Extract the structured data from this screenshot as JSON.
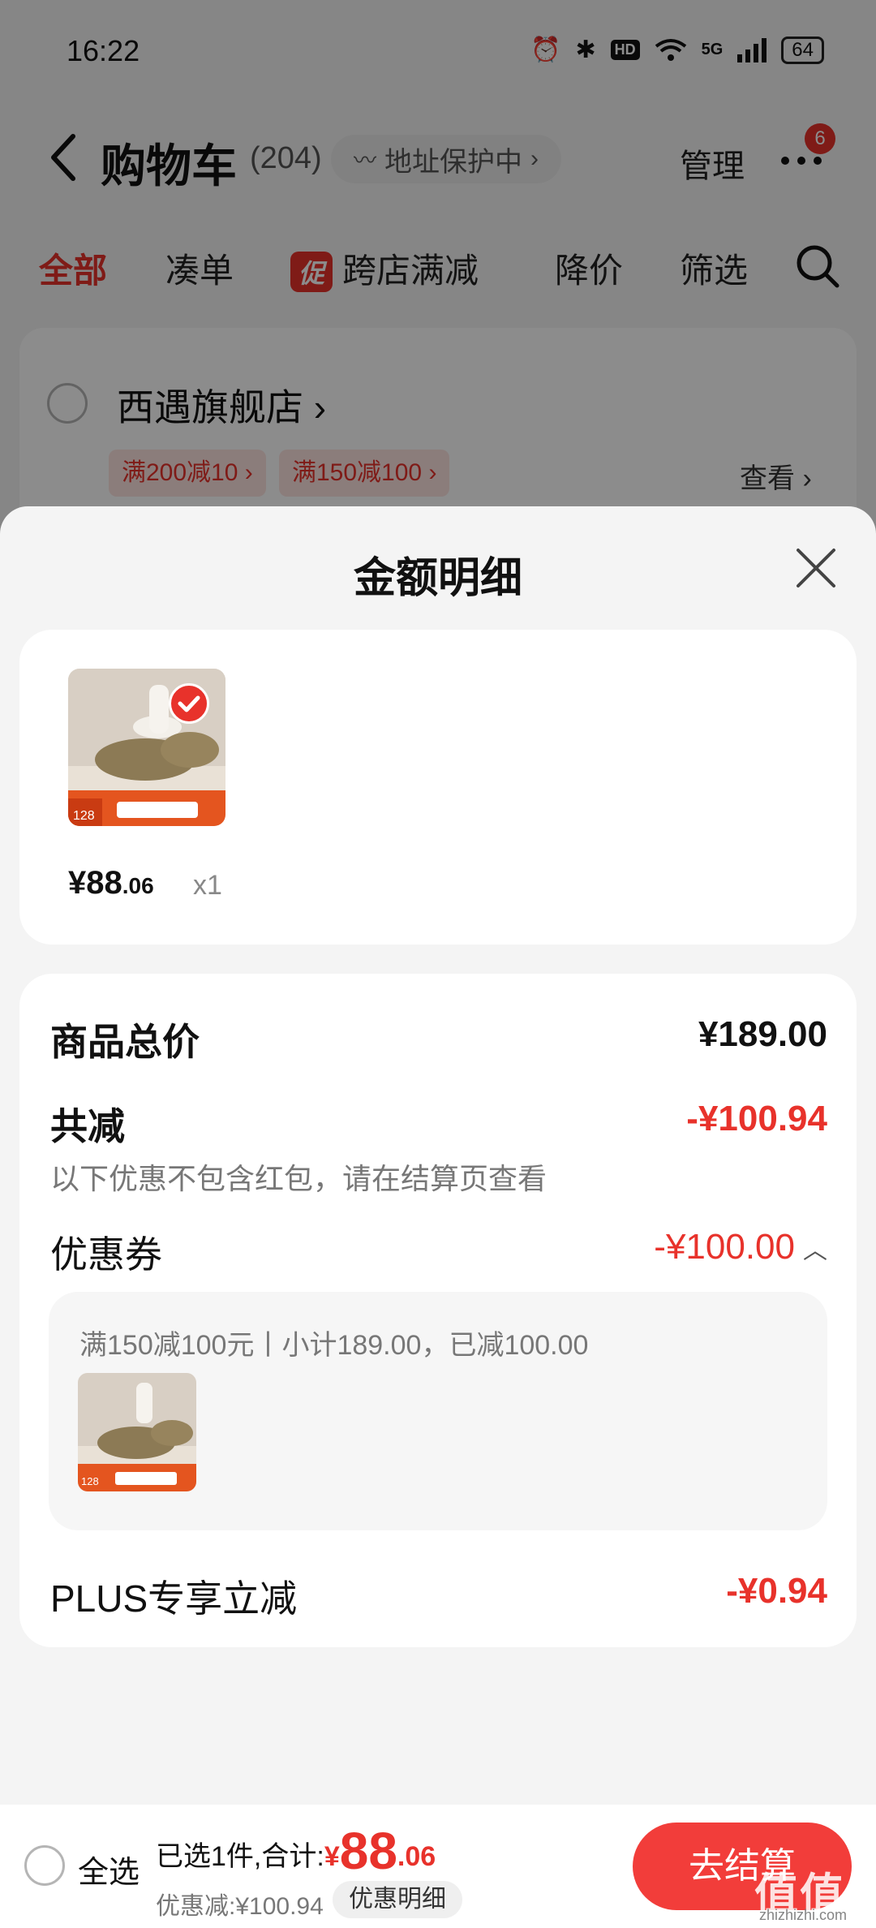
{
  "status_bar": {
    "time": "16:22",
    "network": "5G",
    "battery": "64",
    "hd": "HD"
  },
  "header": {
    "title": "购物车",
    "count": "(204)",
    "address_protect": "地址保护中",
    "manage": "管理",
    "notification_count": "6"
  },
  "filter_tabs": [
    {
      "label": "全部",
      "active": true
    },
    {
      "label": "凑单"
    },
    {
      "label": "跨店满减",
      "tag": "促"
    },
    {
      "label": "降价"
    },
    {
      "label": "筛选"
    }
  ],
  "store": {
    "name": "西遇旗舰店",
    "coupons": [
      "满200减10",
      "满150减100"
    ],
    "view": "查看"
  },
  "sheet": {
    "title": "金额明细",
    "item": {
      "price_main": "¥88",
      "price_cents": ".06",
      "qty": "x1"
    },
    "rows": {
      "total_label": "商品总价",
      "total_value": "¥189.00",
      "discount_label": "共减",
      "discount_value": "-¥100.94",
      "discount_note": "以下优惠不包含红包，请在结算页查看",
      "coupon_label": "优惠券",
      "coupon_value": "-¥100.00",
      "coupon_desc": "满150减100元丨小计189.00，已减100.00",
      "plus_label": "PLUS专享立减",
      "plus_value": "-¥0.94"
    }
  },
  "bottom_bar": {
    "select_all": "全选",
    "selected_text": "已选1件,合计:",
    "currency": "¥",
    "total_main": "88",
    "total_cents": ".06",
    "saved": "优惠减:¥100.94",
    "detail_button": "优惠明细",
    "checkout_button": "去结算"
  },
  "watermark": {
    "main": "值值值",
    "sub": "zhizhizhi.com"
  },
  "colors": {
    "accent": "#e8322b",
    "button": "#f23d3a"
  }
}
